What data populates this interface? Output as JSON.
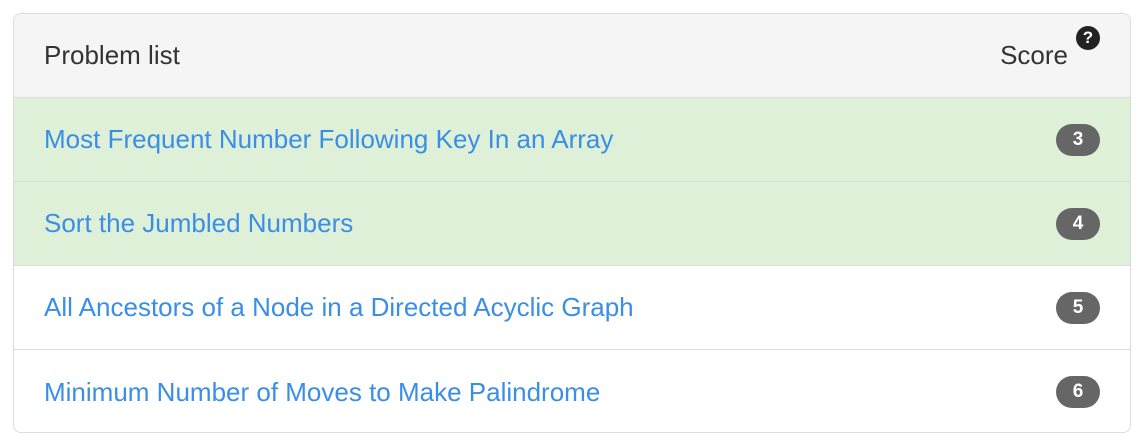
{
  "header": {
    "title": "Problem list",
    "score_label": "Score",
    "help_glyph": "?"
  },
  "problems": [
    {
      "title": "Most Frequent Number Following Key In an Array",
      "score": "3",
      "solved": true
    },
    {
      "title": "Sort the Jumbled Numbers",
      "score": "4",
      "solved": true
    },
    {
      "title": "All Ancestors of a Node in a Directed Acyclic Graph",
      "score": "5",
      "solved": false
    },
    {
      "title": "Minimum Number of Moves to Make Palindrome",
      "score": "6",
      "solved": false
    }
  ],
  "colors": {
    "solved_row": "#dff0d8",
    "link": "#3a8ee6",
    "badge": "#666666"
  }
}
